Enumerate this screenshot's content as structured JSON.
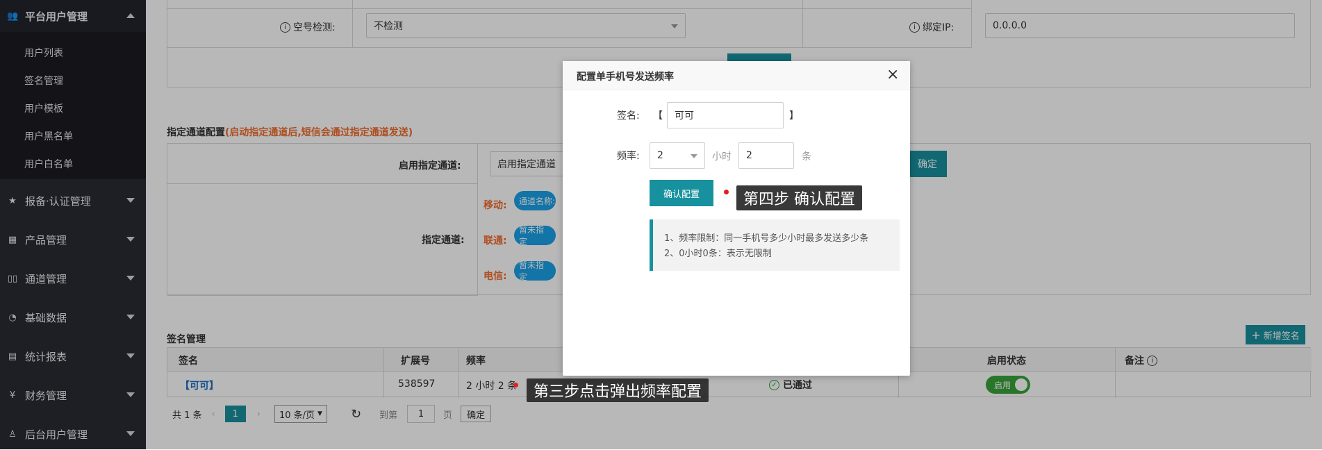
{
  "sidebar": {
    "open_section": {
      "label": "平台用户管理",
      "icon": "users-icon"
    },
    "sub_items": [
      "用户列表",
      "签名管理",
      "用户模板",
      "用户黑名单",
      "用户白名单"
    ],
    "sections": [
      {
        "label": "报备·认证管理",
        "icon": "star-icon"
      },
      {
        "label": "产品管理",
        "icon": "grid-icon"
      },
      {
        "label": "通道管理",
        "icon": "channel-icon"
      },
      {
        "label": "基础数据",
        "icon": "database-icon"
      },
      {
        "label": "统计报表",
        "icon": "report-icon"
      },
      {
        "label": "财务管理",
        "icon": "yen-icon"
      },
      {
        "label": "后台用户管理",
        "icon": "user-icon"
      }
    ]
  },
  "top_form": {
    "empty_check_label": "空号检测:",
    "empty_check_value": "不检测",
    "bind_ip_label": "绑定IP:",
    "bind_ip_value": "0.0.0.0"
  },
  "channel_config": {
    "title": "指定通道配置",
    "note": "(启动指定通道后,短信会通过指定通道发送)",
    "enable_label": "启用指定通道:",
    "enable_value": "启用指定通道",
    "confirm_label": "确定",
    "channel_label": "指定通道:",
    "mobile_label": "移动:",
    "mobile_chip": "通道名称: ",
    "unicom_label": "联通:",
    "unicom_chip": "暂未指定",
    "telecom_label": "电信:",
    "telecom_chip": "暂未指定"
  },
  "signature": {
    "title": "签名管理",
    "add_button": "新增签名",
    "headers": [
      "签名",
      "扩展号",
      "频率",
      "启用状态",
      "备注"
    ],
    "row": {
      "name": "【可可】",
      "ext": "538597",
      "freq": "2 小时 2 条",
      "audit": "已通过",
      "toggle": "启用"
    },
    "pagination": {
      "total": "共 1 条",
      "page": "1",
      "page_size": "10 条/页",
      "goto_label": "到第",
      "goto_value": "1",
      "page_unit": "页",
      "confirm": "确定"
    }
  },
  "modal": {
    "title": "配置单手机号发送频率",
    "sign_label": "签名:",
    "bracket_left": "【",
    "bracket_right": "】",
    "sign_value": "可可",
    "freq_label": "频率:",
    "hours_value": "2",
    "hours_unit": "小时",
    "count_value": "2",
    "count_unit": "条",
    "confirm_button": "确认配置",
    "info_line1": "1、频率限制：同一手机号多少小时最多发送多少条",
    "info_line2": "2、0小时0条：表示无限制"
  },
  "annotations": {
    "step3": "第三步点击弹出频率配置",
    "step4": "第四步 确认配置"
  },
  "colors": {
    "sidebar": "#2a2c33",
    "teal": "#18919e",
    "orange": "#f26b2b",
    "chip_blue": "#1aa1e8",
    "toggle_green": "#3aa33a"
  }
}
